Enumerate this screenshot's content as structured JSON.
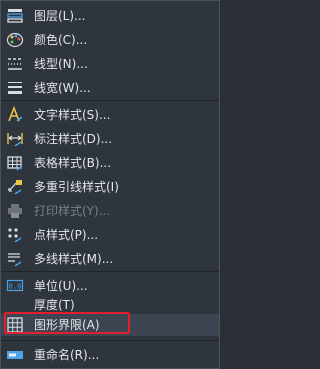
{
  "menu": {
    "items": [
      {
        "label": "图层(L)...",
        "icon": "layers-icon"
      },
      {
        "label": "颜色(C)...",
        "icon": "color-palette-icon"
      },
      {
        "label": "线型(N)...",
        "icon": "linetype-icon"
      },
      {
        "label": "线宽(W)...",
        "icon": "lineweight-icon"
      },
      {
        "label": "文字样式(S)...",
        "icon": "text-style-icon"
      },
      {
        "label": "标注样式(D)...",
        "icon": "dimension-style-icon"
      },
      {
        "label": "表格样式(B)...",
        "icon": "table-style-icon"
      },
      {
        "label": "多重引线样式(I)",
        "icon": "multileader-style-icon"
      },
      {
        "label": "打印样式(Y)...",
        "icon": "plot-style-icon",
        "disabled": true
      },
      {
        "label": "点样式(P)...",
        "icon": "point-style-icon"
      },
      {
        "label": "多线样式(M)...",
        "icon": "multiline-style-icon"
      },
      {
        "label": "单位(U)...",
        "icon": "units-icon"
      },
      {
        "label": "厚度(T)"
      },
      {
        "label": "图形界限(A)",
        "icon": "drawing-limits-icon",
        "highlighted": true
      },
      {
        "label": "重命名(R)...",
        "icon": "rename-icon"
      }
    ]
  },
  "colors": {
    "accent": "#e0202a",
    "icon_blue": "#4aa3e8",
    "icon_yellow": "#e8c64a"
  }
}
